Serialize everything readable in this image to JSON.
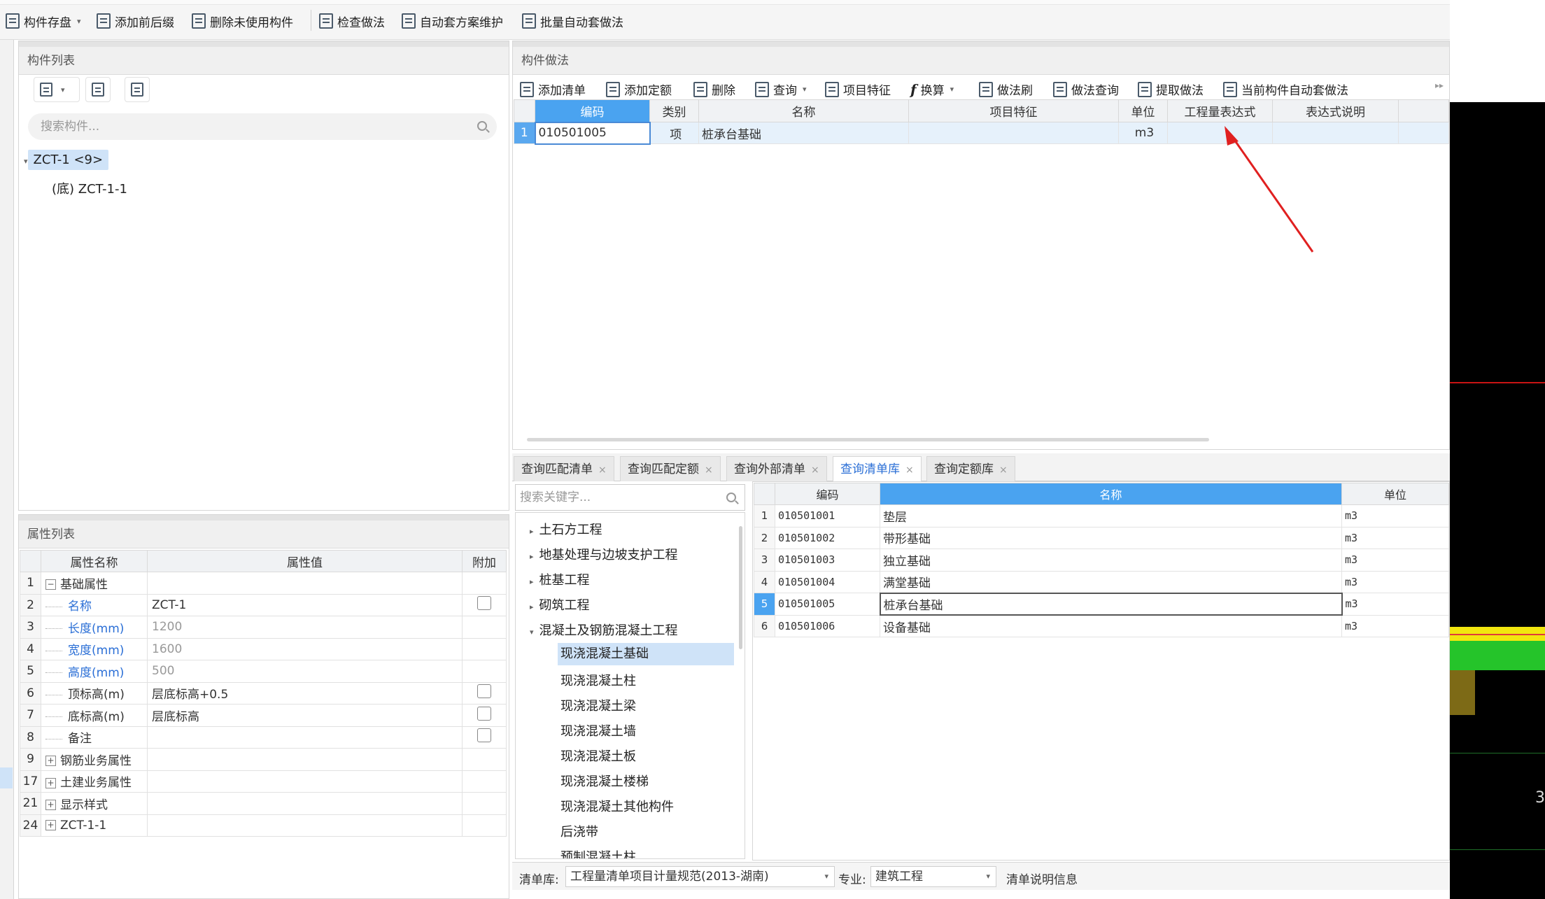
{
  "toolbar": {
    "items": [
      {
        "label": "构件存盘",
        "icon": "save-component-icon",
        "dropdown": true
      },
      {
        "label": "添加前后缀",
        "icon": "add-affix-icon"
      },
      {
        "label": "删除未使用构件",
        "icon": "delete-unused-icon"
      },
      {
        "label": "检查做法",
        "icon": "check-method-icon"
      },
      {
        "label": "自动套方案维护",
        "icon": "auto-scheme-icon"
      },
      {
        "label": "批量自动套做法",
        "icon": "batch-auto-icon"
      }
    ]
  },
  "component_list": {
    "title": "构件列表",
    "search_placeholder": "搜索构件...",
    "tree": {
      "root": "ZCT-1 <9>",
      "child": "(底) ZCT-1-1"
    }
  },
  "property_list": {
    "title": "属性列表",
    "headers": {
      "name": "属性名称",
      "value": "属性值",
      "extra": "附加"
    },
    "rows": [
      {
        "num": "1",
        "name": "基础属性",
        "value": "",
        "group": "-"
      },
      {
        "num": "2",
        "name": "名称",
        "value": "ZCT-1",
        "checkbox": true,
        "blue": true
      },
      {
        "num": "3",
        "name": "长度(mm)",
        "value": "1200",
        "blue": true,
        "gray": true
      },
      {
        "num": "4",
        "name": "宽度(mm)",
        "value": "1600",
        "blue": true,
        "gray": true
      },
      {
        "num": "5",
        "name": "高度(mm)",
        "value": "500",
        "blue": true,
        "gray": true
      },
      {
        "num": "6",
        "name": "顶标高(m)",
        "value": "层底标高+0.5",
        "checkbox": true
      },
      {
        "num": "7",
        "name": "底标高(m)",
        "value": "层底标高",
        "checkbox": true
      },
      {
        "num": "8",
        "name": "备注",
        "value": "",
        "checkbox": true
      },
      {
        "num": "9",
        "name": "钢筋业务属性",
        "value": "",
        "group": "+"
      },
      {
        "num": "17",
        "name": "土建业务属性",
        "value": "",
        "group": "+"
      },
      {
        "num": "21",
        "name": "显示样式",
        "value": "",
        "group": "+"
      },
      {
        "num": "24",
        "name": "ZCT-1-1",
        "value": "",
        "group": "+"
      }
    ]
  },
  "method_panel": {
    "title": "构件做法",
    "toolbar": [
      {
        "label": "添加清单",
        "icon": "add-list-icon"
      },
      {
        "label": "添加定额",
        "icon": "add-quota-icon"
      },
      {
        "label": "删除",
        "icon": "trash-icon"
      },
      {
        "label": "查询",
        "icon": "query-icon",
        "dropdown": true
      },
      {
        "label": "项目特征",
        "icon": "feature-icon"
      },
      {
        "label": "换算",
        "icon": "function-icon",
        "dropdown": true
      },
      {
        "label": "做法刷",
        "icon": "method-brush-icon"
      },
      {
        "label": "做法查询",
        "icon": "method-query-icon"
      },
      {
        "label": "提取做法",
        "icon": "extract-method-icon"
      },
      {
        "label": "当前构件自动套做法",
        "icon": "auto-apply-icon"
      }
    ],
    "headers": [
      "编码",
      "类别",
      "名称",
      "项目特征",
      "单位",
      "工程量表达式",
      "表达式说明"
    ],
    "rows": [
      {
        "num": "1",
        "code": "010501005",
        "type": "项",
        "name": "桩承台基础",
        "feature": "",
        "unit": "m3",
        "expr": "",
        "desc": ""
      }
    ]
  },
  "query_tabs": [
    {
      "label": "查询匹配清单",
      "active": false
    },
    {
      "label": "查询匹配定额",
      "active": false
    },
    {
      "label": "查询外部清单",
      "active": false
    },
    {
      "label": "查询清单库",
      "active": true
    },
    {
      "label": "查询定额库",
      "active": false
    }
  ],
  "category": {
    "search_placeholder": "搜索关键字...",
    "items": [
      {
        "label": "土石方工程",
        "level": 0,
        "arrow": "▸"
      },
      {
        "label": "地基处理与边坡支护工程",
        "level": 0,
        "arrow": "▸"
      },
      {
        "label": "桩基工程",
        "level": 0,
        "arrow": "▸"
      },
      {
        "label": "砌筑工程",
        "level": 0,
        "arrow": "▸"
      },
      {
        "label": "混凝土及钢筋混凝土工程",
        "level": 0,
        "arrow": "▾"
      },
      {
        "label": "现浇混凝土基础",
        "level": 1,
        "selected": true
      },
      {
        "label": "现浇混凝土柱",
        "level": 1
      },
      {
        "label": "现浇混凝土梁",
        "level": 1
      },
      {
        "label": "现浇混凝土墙",
        "level": 1
      },
      {
        "label": "现浇混凝土板",
        "level": 1
      },
      {
        "label": "现浇混凝土楼梯",
        "level": 1
      },
      {
        "label": "现浇混凝土其他构件",
        "level": 1
      },
      {
        "label": "后浇带",
        "level": 1
      },
      {
        "label": "预制混凝土柱",
        "level": 1
      }
    ]
  },
  "list_library": {
    "headers": {
      "code": "编码",
      "name": "名称",
      "unit": "单位"
    },
    "rows": [
      {
        "num": "1",
        "code": "010501001",
        "name": "垫层",
        "unit": "m3"
      },
      {
        "num": "2",
        "code": "010501002",
        "name": "带形基础",
        "unit": "m3"
      },
      {
        "num": "3",
        "code": "010501003",
        "name": "独立基础",
        "unit": "m3"
      },
      {
        "num": "4",
        "code": "010501004",
        "name": "满堂基础",
        "unit": "m3"
      },
      {
        "num": "5",
        "code": "010501005",
        "name": "桩承台基础",
        "unit": "m3",
        "selected": true
      },
      {
        "num": "6",
        "code": "010501006",
        "name": "设备基础",
        "unit": "m3"
      }
    ]
  },
  "statusbar": {
    "library_label": "清单库:",
    "library_value": "工程量清单项目计量规范(2013-湖南)",
    "major_label": "专业:",
    "major_value": "建筑工程",
    "info_label": "清单说明信息"
  },
  "canvas": {
    "label": "3"
  },
  "colors": {
    "accent": "#4aa3f0",
    "selection": "#cfe3f8",
    "property_blue": "#2b6fd6",
    "arrow_red": "#e02020"
  }
}
